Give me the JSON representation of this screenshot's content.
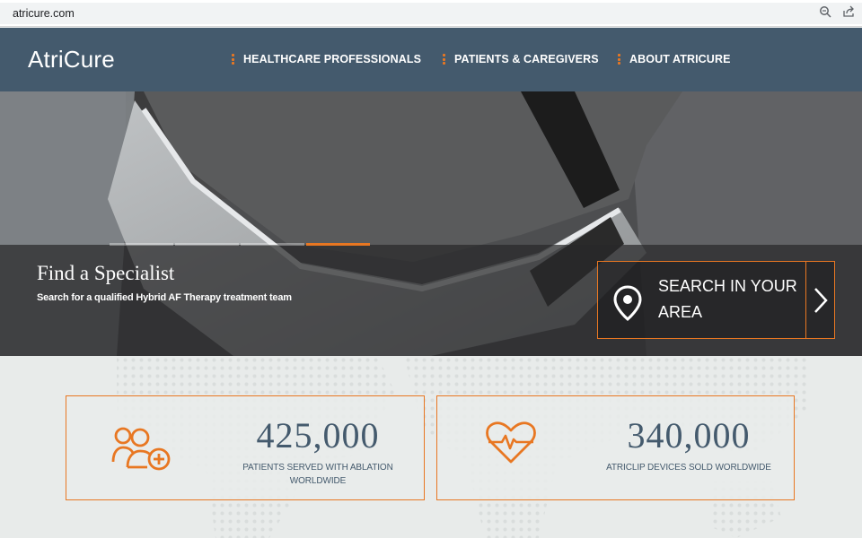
{
  "browser": {
    "url": "atricure.com",
    "icons": [
      "lock-icon",
      "zoom-icon",
      "share-icon"
    ]
  },
  "header": {
    "logo": "AtriCure",
    "nav": [
      {
        "label": "HEALTHCARE PROFESSIONALS"
      },
      {
        "label": "PATIENTS & CAREGIVERS"
      },
      {
        "label": "ABOUT ATRICURE"
      }
    ]
  },
  "hero": {
    "title": "Find a Specialist",
    "subtitle": "Search for a qualified Hybrid AF Therapy treatment team",
    "search_button": "SEARCH IN YOUR AREA",
    "slides": 4,
    "active_slide": 4
  },
  "stats": [
    {
      "number": "425,000",
      "label": "PATIENTS SERVED WITH ABLATION WORLDWIDE",
      "icon": "patients-plus-icon"
    },
    {
      "number": "340,000",
      "label": "ATRICLIP DEVICES SOLD WORLDWIDE",
      "icon": "heart-pulse-icon"
    }
  ],
  "colors": {
    "header_bg": "#445a6d",
    "accent": "#e87722",
    "stats_bg": "#e8ebea",
    "stat_text": "#445a6d"
  }
}
